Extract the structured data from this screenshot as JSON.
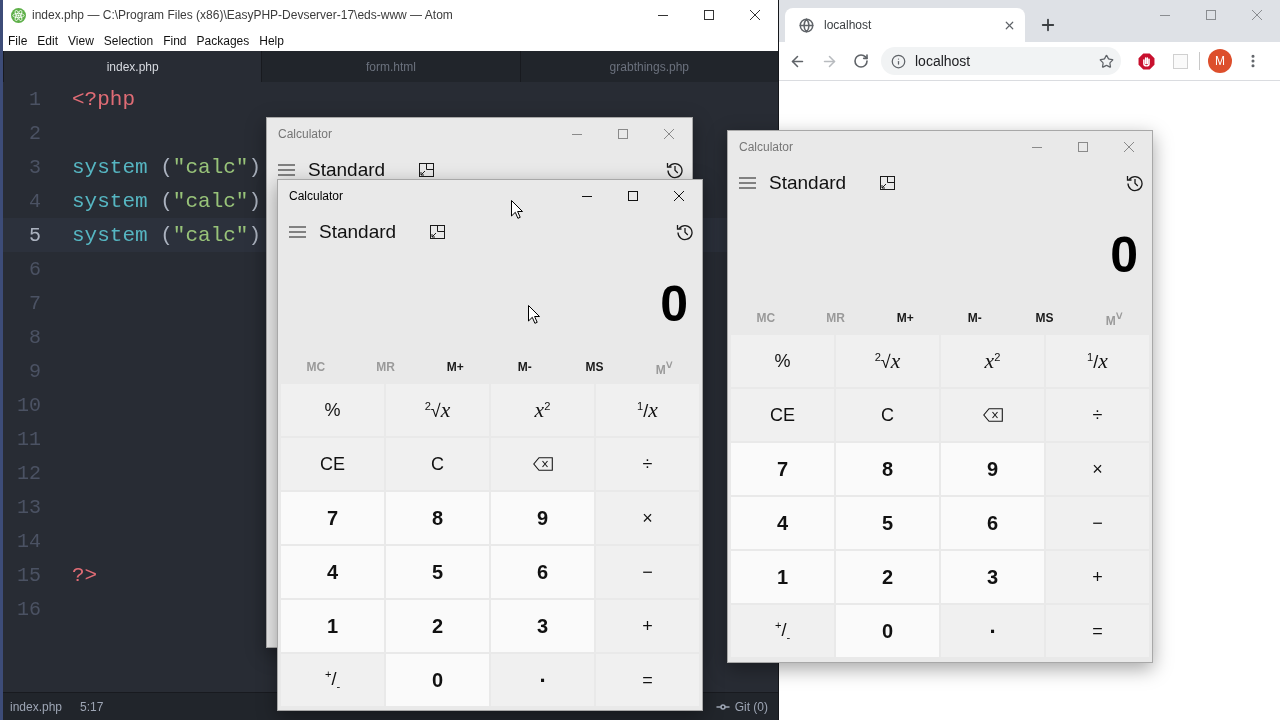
{
  "editor": {
    "window": {
      "title": "index.php — C:\\Program Files (x86)\\EasyPHP-Devserver-17\\eds-www — Atom"
    },
    "menu": [
      "File",
      "Edit",
      "View",
      "Selection",
      "Find",
      "Packages",
      "Help"
    ],
    "tabs": [
      {
        "label": "index.php",
        "selected": true
      },
      {
        "label": "form.html",
        "selected": false
      },
      {
        "label": "grabthings.php",
        "selected": false
      }
    ],
    "lines": [
      {
        "number": "1",
        "current": false,
        "tokens": [
          {
            "kind": "keyword",
            "text": "<?php"
          }
        ]
      },
      {
        "number": "2",
        "current": false
      },
      {
        "number": "3",
        "current": false,
        "tokens": [
          {
            "kind": "function",
            "text": "system"
          },
          {
            "kind": "punct",
            "text": " ("
          },
          {
            "kind": "string",
            "text": "\"calc\""
          },
          {
            "kind": "punct",
            "text": ")"
          }
        ]
      },
      {
        "number": "4",
        "current": false,
        "tokens": [
          {
            "kind": "function",
            "text": "system"
          },
          {
            "kind": "punct",
            "text": " ("
          },
          {
            "kind": "string",
            "text": "\"calc\""
          },
          {
            "kind": "punct",
            "text": ")"
          }
        ]
      },
      {
        "number": "5",
        "current": true,
        "tokens": [
          {
            "kind": "function",
            "text": "system"
          },
          {
            "kind": "punct",
            "text": " ("
          },
          {
            "kind": "string",
            "text": "\"calc\""
          },
          {
            "kind": "punct",
            "text": ")"
          }
        ]
      },
      {
        "number": "6",
        "current": false
      },
      {
        "number": "7",
        "current": false
      },
      {
        "number": "8",
        "current": false
      },
      {
        "number": "9",
        "current": false
      },
      {
        "number": "10",
        "current": false
      },
      {
        "number": "11",
        "current": false
      },
      {
        "number": "12",
        "current": false
      },
      {
        "number": "13",
        "current": false
      },
      {
        "number": "14",
        "current": false
      },
      {
        "number": "15",
        "current": false,
        "tokens": [
          {
            "kind": "keyword",
            "text": "?>"
          }
        ]
      },
      {
        "number": "16",
        "current": false
      }
    ],
    "status_bar": {
      "file": "index.php",
      "cursor": "5:17",
      "git": "Git (0)"
    }
  },
  "browser": {
    "tabs": [
      {
        "label": "localhost",
        "selected": true
      }
    ],
    "address": "localhost",
    "avatar": "M"
  },
  "calculators": [
    {
      "title": "Calculator",
      "active": false,
      "mode": "Standard"
    },
    {
      "title": "Calculator",
      "active": true,
      "mode": "Standard",
      "display": "0",
      "memory": [
        {
          "label": "MC",
          "disabled": true
        },
        {
          "label": "MR",
          "disabled": true
        },
        {
          "label": "M+",
          "disabled": false
        },
        {
          "label": "M-",
          "disabled": false
        },
        {
          "label": "MS",
          "disabled": false
        },
        {
          "label": "M$^{˅}$",
          "disabled": true
        }
      ],
      "keys": [
        {
          "kind": "op",
          "label": "%"
        },
        {
          "kind": "op",
          "label": "$^{2}$√*x*"
        },
        {
          "kind": "op",
          "label": "*x*$^{2}$"
        },
        {
          "kind": "op",
          "label": "$^{1}$/*x*"
        },
        {
          "kind": "op",
          "label": "CE"
        },
        {
          "kind": "op",
          "label": "C"
        },
        {
          "kind": "backspace"
        },
        {
          "kind": "op",
          "label": "÷"
        },
        {
          "kind": "digit",
          "label": "7"
        },
        {
          "kind": "digit",
          "label": "8"
        },
        {
          "kind": "digit",
          "label": "9"
        },
        {
          "kind": "op",
          "label": "×"
        },
        {
          "kind": "digit",
          "label": "4"
        },
        {
          "kind": "digit",
          "label": "5"
        },
        {
          "kind": "digit",
          "label": "6"
        },
        {
          "kind": "op",
          "label": "−"
        },
        {
          "kind": "digit",
          "label": "1"
        },
        {
          "kind": "digit",
          "label": "2"
        },
        {
          "kind": "digit",
          "label": "3"
        },
        {
          "kind": "op",
          "label": "+"
        },
        {
          "kind": "op",
          "label": "$^{+}$/$_{-}$"
        },
        {
          "kind": "digit",
          "label": "0"
        },
        {
          "kind": "decimal",
          "label": "."
        },
        {
          "kind": "op",
          "label": "="
        }
      ]
    },
    {
      "title": "Calculator",
      "active": false,
      "mode": "Standard",
      "display": "0",
      "memory": [
        {
          "label": "MC",
          "disabled": true
        },
        {
          "label": "MR",
          "disabled": true
        },
        {
          "label": "M+",
          "disabled": false
        },
        {
          "label": "M-",
          "disabled": false
        },
        {
          "label": "MS",
          "disabled": false
        },
        {
          "label": "M$^{˅}$",
          "disabled": true
        }
      ],
      "keys": [
        {
          "kind": "op",
          "label": "%"
        },
        {
          "kind": "op",
          "label": "$^{2}$√*x*"
        },
        {
          "kind": "op",
          "label": "*x*$^{2}$"
        },
        {
          "kind": "op",
          "label": "$^{1}$/*x*"
        },
        {
          "kind": "op",
          "label": "CE"
        },
        {
          "kind": "op",
          "label": "C"
        },
        {
          "kind": "backspace"
        },
        {
          "kind": "op",
          "label": "÷"
        },
        {
          "kind": "digit",
          "label": "7"
        },
        {
          "kind": "digit",
          "label": "8"
        },
        {
          "kind": "digit",
          "label": "9"
        },
        {
          "kind": "op",
          "label": "×"
        },
        {
          "kind": "digit",
          "label": "4"
        },
        {
          "kind": "digit",
          "label": "5"
        },
        {
          "kind": "digit",
          "label": "6"
        },
        {
          "kind": "op",
          "label": "−"
        },
        {
          "kind": "digit",
          "label": "1"
        },
        {
          "kind": "digit",
          "label": "2"
        },
        {
          "kind": "digit",
          "label": "3"
        },
        {
          "kind": "op",
          "label": "+"
        },
        {
          "kind": "op",
          "label": "$^{+}$/$_{-}$"
        },
        {
          "kind": "digit",
          "label": "0"
        },
        {
          "kind": "decimal",
          "label": "."
        },
        {
          "kind": "op",
          "label": "="
        }
      ]
    }
  ]
}
